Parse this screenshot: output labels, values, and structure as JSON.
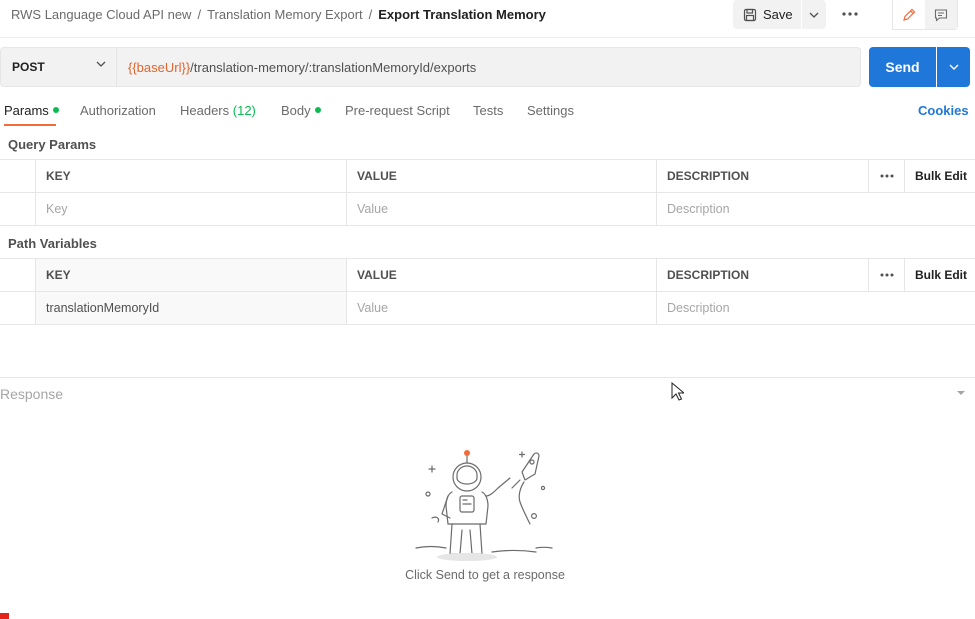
{
  "breadcrumb": {
    "items": [
      "RWS Language Cloud API new",
      "Translation Memory Export"
    ],
    "separator": "/",
    "current": "Export Translation Memory"
  },
  "toolbar": {
    "save_label": "Save",
    "save_icon": "save-icon",
    "more_icon": "more-horizontal-icon",
    "edit_icon": "pencil-icon",
    "comment_icon": "comment-icon"
  },
  "request": {
    "method": "POST",
    "url_variable": "{{baseUrl}}",
    "url_path": "/translation-memory/:translationMemoryId/exports",
    "send_label": "Send"
  },
  "tabs": {
    "params": "Params",
    "authorization": "Authorization",
    "headers": "Headers",
    "headers_count": "(12)",
    "body": "Body",
    "prerequest": "Pre-request Script",
    "tests": "Tests",
    "settings": "Settings",
    "cookies": "Cookies"
  },
  "query_params": {
    "title": "Query Params",
    "headers": {
      "key": "KEY",
      "value": "VALUE",
      "description": "DESCRIPTION",
      "bulk_edit": "Bulk Edit"
    },
    "placeholders": {
      "key": "Key",
      "value": "Value",
      "description": "Description"
    }
  },
  "path_variables": {
    "title": "Path Variables",
    "headers": {
      "key": "KEY",
      "value": "VALUE",
      "description": "DESCRIPTION",
      "bulk_edit": "Bulk Edit"
    },
    "rows": [
      {
        "key": "translationMemoryId",
        "value_placeholder": "Value",
        "description_placeholder": "Description"
      }
    ]
  },
  "response": {
    "title": "Response",
    "hint": "Click Send to get a response"
  },
  "colors": {
    "accent_blue": "#1f78d9",
    "variable_orange": "#e0652d",
    "active_tab_underline": "#f26b3a",
    "status_green": "#0cbb52"
  }
}
